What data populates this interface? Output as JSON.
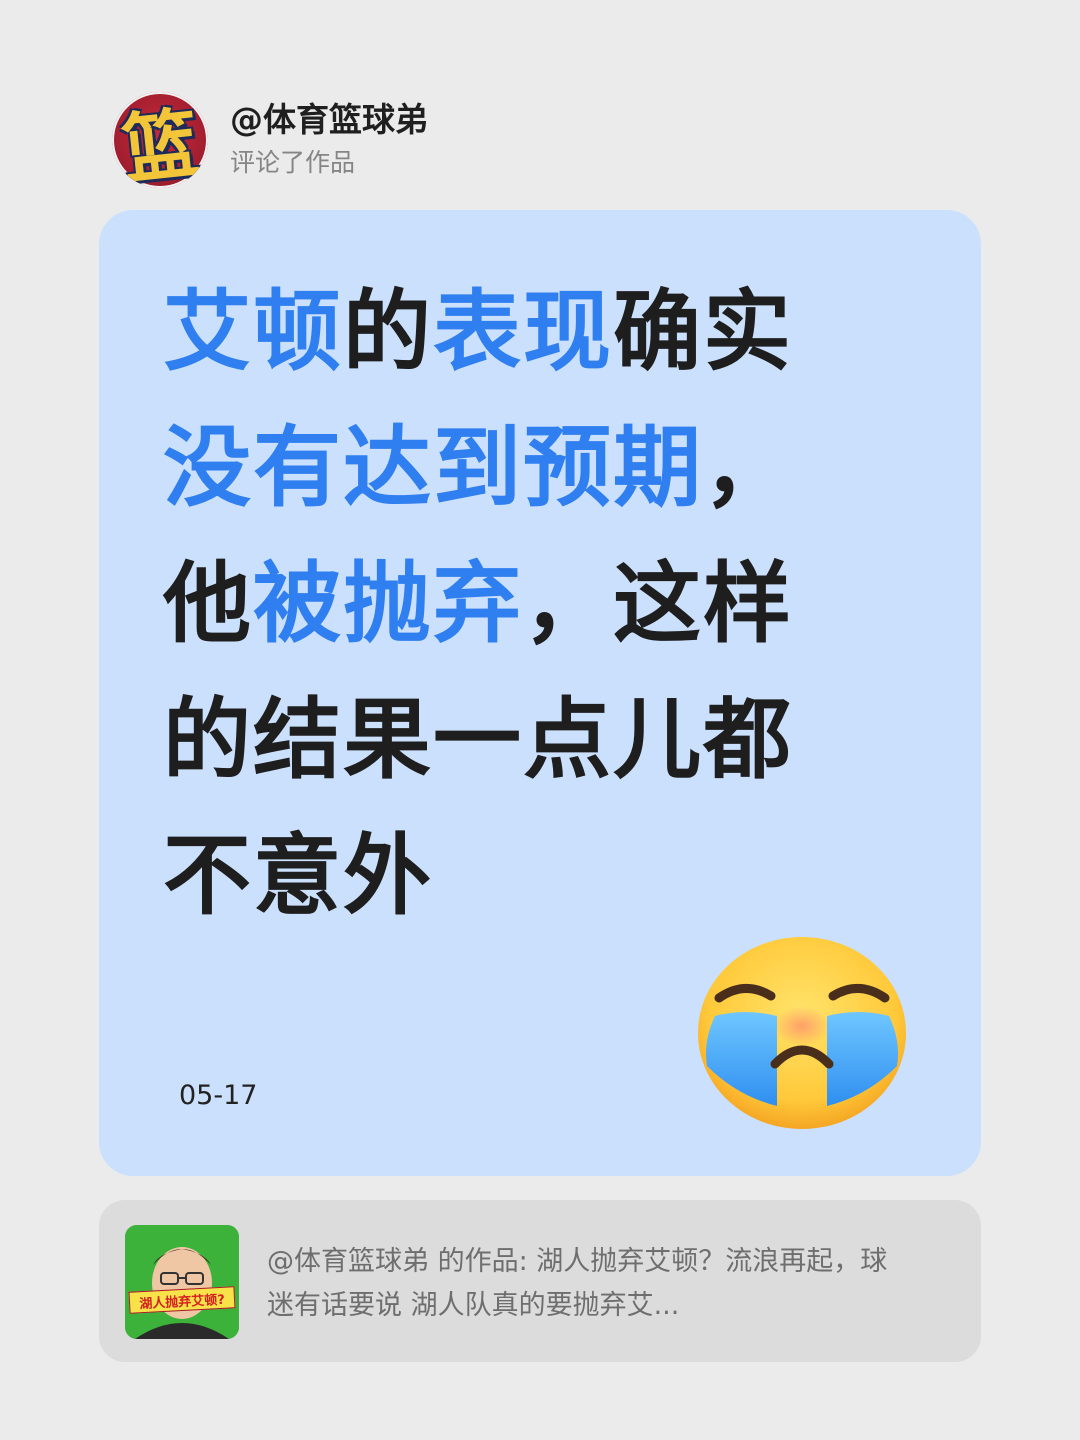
{
  "header": {
    "avatar_icon": "avatar-basketball-logo",
    "avatar_glyph": "篮",
    "username": "@体育篮球弟",
    "action": "评论了作品"
  },
  "comment": {
    "lines": [
      [
        {
          "t": "艾顿",
          "hl": true
        },
        {
          "t": "的",
          "hl": false
        },
        {
          "t": "表现",
          "hl": true
        },
        {
          "t": "确实",
          "hl": false
        }
      ],
      [
        {
          "t": "没有达到预期",
          "hl": true
        },
        {
          "t": "，",
          "hl": false
        }
      ],
      [
        {
          "t": "他",
          "hl": false
        },
        {
          "t": "被抛弃",
          "hl": true
        },
        {
          "t": "，这样",
          "hl": false
        }
      ],
      [
        {
          "t": "的结果一点儿都",
          "hl": false
        }
      ],
      [
        {
          "t": "不意外",
          "hl": false
        }
      ]
    ],
    "date": "05-17",
    "emoji_icon": "loudly-crying-face-icon",
    "highlight_color": "#2f7ff0",
    "text_color": "#1e1e1e",
    "card_color": "#cbe0fc"
  },
  "work_ref": {
    "thumb_caption": "湖人抛弃艾顿?",
    "text": "@体育篮球弟 的作品: 湖人抛弃艾顿？流浪再起，球迷有话要说 湖人队真的要抛弃艾..."
  }
}
